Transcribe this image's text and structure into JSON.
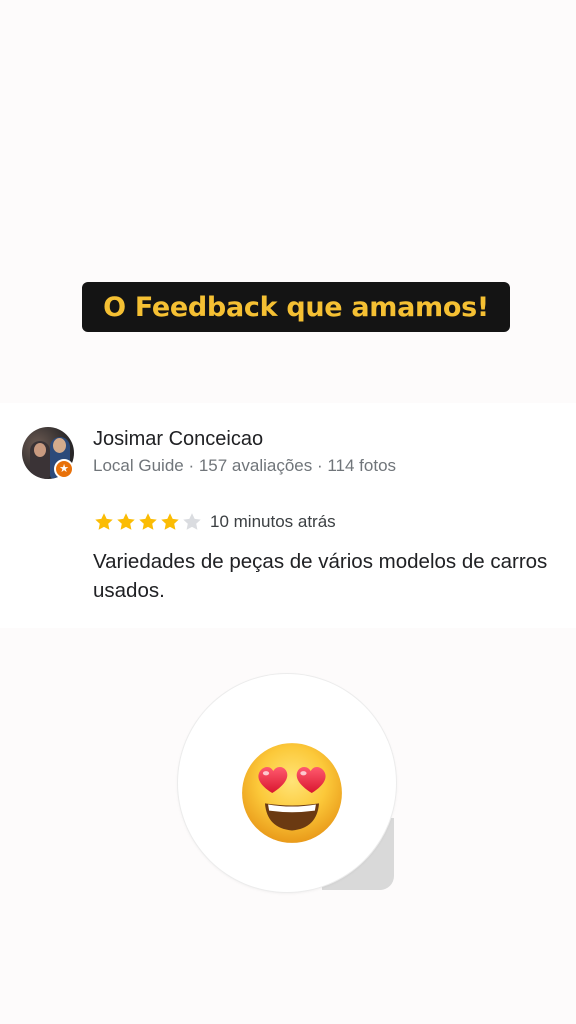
{
  "banner": {
    "title": "O Feedback que amamos!"
  },
  "review": {
    "reviewer_name": "Josimar Conceicao",
    "reviewer_meta": "Local Guide · 157 avaliações · 114 fotos",
    "rating": 4,
    "rating_max": 5,
    "time_ago": "10 minutos atrás",
    "text": "Variedades de peças de vários modelos de carros usados."
  },
  "reaction": {
    "emoji": "heart-eyes-face-icon"
  },
  "colors": {
    "banner_bg": "#141414",
    "banner_text": "#f5c033",
    "star_filled": "#fbbc04",
    "star_empty": "#dadce0",
    "local_guide_badge": "#e8710a"
  }
}
